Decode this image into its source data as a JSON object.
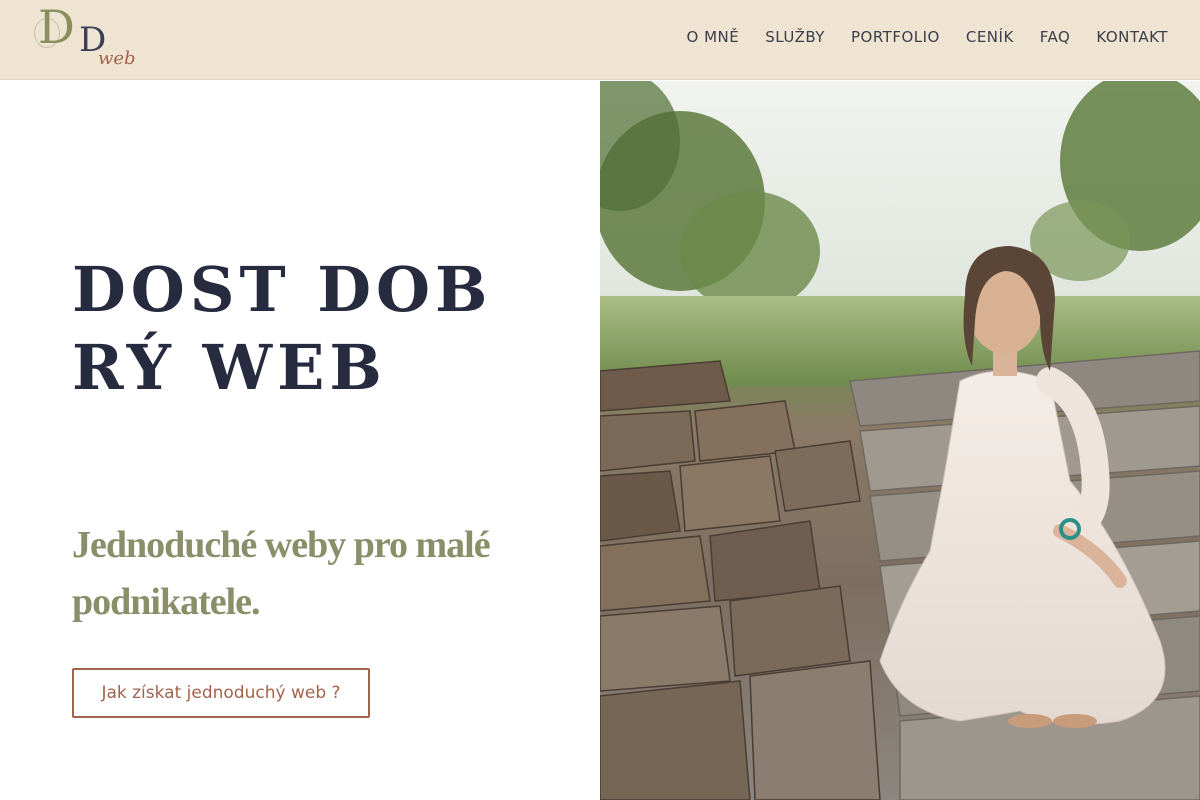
{
  "logo": {
    "letter1": "D",
    "letter2": "D",
    "suffix": "web"
  },
  "nav": {
    "items": [
      {
        "label": "O MNĚ"
      },
      {
        "label": "SLUŽBY"
      },
      {
        "label": "PORTFOLIO"
      },
      {
        "label": "CENÍK"
      },
      {
        "label": "FAQ"
      },
      {
        "label": "KONTAKT"
      }
    ]
  },
  "hero": {
    "headline": "DOST DOBRÝ WEB",
    "subtitle": "Jednoduché weby pro malé podnikatele.",
    "cta_label": "Jak získat jednoduchý web ?"
  },
  "colors": {
    "header_bg": "#efe4d2",
    "headline": "#262b3f",
    "subtitle": "#8a8f6a",
    "accent": "#a2634d"
  }
}
